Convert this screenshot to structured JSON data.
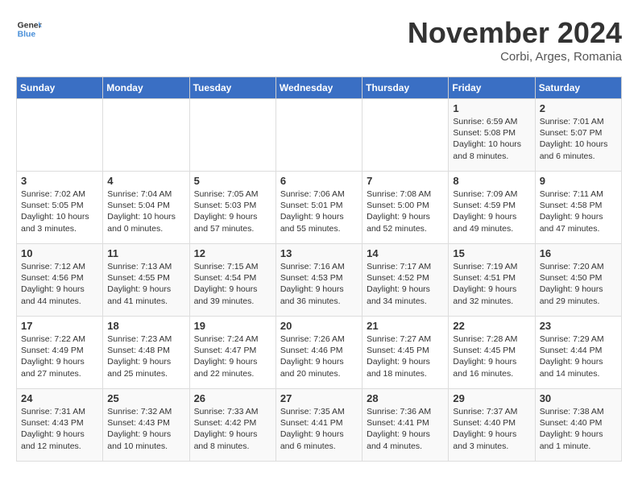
{
  "header": {
    "logo_general": "General",
    "logo_blue": "Blue",
    "month_title": "November 2024",
    "location": "Corbi, Arges, Romania"
  },
  "weekdays": [
    "Sunday",
    "Monday",
    "Tuesday",
    "Wednesday",
    "Thursday",
    "Friday",
    "Saturday"
  ],
  "weeks": [
    [
      {
        "day": "",
        "info": ""
      },
      {
        "day": "",
        "info": ""
      },
      {
        "day": "",
        "info": ""
      },
      {
        "day": "",
        "info": ""
      },
      {
        "day": "",
        "info": ""
      },
      {
        "day": "1",
        "info": "Sunrise: 6:59 AM\nSunset: 5:08 PM\nDaylight: 10 hours and 8 minutes."
      },
      {
        "day": "2",
        "info": "Sunrise: 7:01 AM\nSunset: 5:07 PM\nDaylight: 10 hours and 6 minutes."
      }
    ],
    [
      {
        "day": "3",
        "info": "Sunrise: 7:02 AM\nSunset: 5:05 PM\nDaylight: 10 hours and 3 minutes."
      },
      {
        "day": "4",
        "info": "Sunrise: 7:04 AM\nSunset: 5:04 PM\nDaylight: 10 hours and 0 minutes."
      },
      {
        "day": "5",
        "info": "Sunrise: 7:05 AM\nSunset: 5:03 PM\nDaylight: 9 hours and 57 minutes."
      },
      {
        "day": "6",
        "info": "Sunrise: 7:06 AM\nSunset: 5:01 PM\nDaylight: 9 hours and 55 minutes."
      },
      {
        "day": "7",
        "info": "Sunrise: 7:08 AM\nSunset: 5:00 PM\nDaylight: 9 hours and 52 minutes."
      },
      {
        "day": "8",
        "info": "Sunrise: 7:09 AM\nSunset: 4:59 PM\nDaylight: 9 hours and 49 minutes."
      },
      {
        "day": "9",
        "info": "Sunrise: 7:11 AM\nSunset: 4:58 PM\nDaylight: 9 hours and 47 minutes."
      }
    ],
    [
      {
        "day": "10",
        "info": "Sunrise: 7:12 AM\nSunset: 4:56 PM\nDaylight: 9 hours and 44 minutes."
      },
      {
        "day": "11",
        "info": "Sunrise: 7:13 AM\nSunset: 4:55 PM\nDaylight: 9 hours and 41 minutes."
      },
      {
        "day": "12",
        "info": "Sunrise: 7:15 AM\nSunset: 4:54 PM\nDaylight: 9 hours and 39 minutes."
      },
      {
        "day": "13",
        "info": "Sunrise: 7:16 AM\nSunset: 4:53 PM\nDaylight: 9 hours and 36 minutes."
      },
      {
        "day": "14",
        "info": "Sunrise: 7:17 AM\nSunset: 4:52 PM\nDaylight: 9 hours and 34 minutes."
      },
      {
        "day": "15",
        "info": "Sunrise: 7:19 AM\nSunset: 4:51 PM\nDaylight: 9 hours and 32 minutes."
      },
      {
        "day": "16",
        "info": "Sunrise: 7:20 AM\nSunset: 4:50 PM\nDaylight: 9 hours and 29 minutes."
      }
    ],
    [
      {
        "day": "17",
        "info": "Sunrise: 7:22 AM\nSunset: 4:49 PM\nDaylight: 9 hours and 27 minutes."
      },
      {
        "day": "18",
        "info": "Sunrise: 7:23 AM\nSunset: 4:48 PM\nDaylight: 9 hours and 25 minutes."
      },
      {
        "day": "19",
        "info": "Sunrise: 7:24 AM\nSunset: 4:47 PM\nDaylight: 9 hours and 22 minutes."
      },
      {
        "day": "20",
        "info": "Sunrise: 7:26 AM\nSunset: 4:46 PM\nDaylight: 9 hours and 20 minutes."
      },
      {
        "day": "21",
        "info": "Sunrise: 7:27 AM\nSunset: 4:45 PM\nDaylight: 9 hours and 18 minutes."
      },
      {
        "day": "22",
        "info": "Sunrise: 7:28 AM\nSunset: 4:45 PM\nDaylight: 9 hours and 16 minutes."
      },
      {
        "day": "23",
        "info": "Sunrise: 7:29 AM\nSunset: 4:44 PM\nDaylight: 9 hours and 14 minutes."
      }
    ],
    [
      {
        "day": "24",
        "info": "Sunrise: 7:31 AM\nSunset: 4:43 PM\nDaylight: 9 hours and 12 minutes."
      },
      {
        "day": "25",
        "info": "Sunrise: 7:32 AM\nSunset: 4:43 PM\nDaylight: 9 hours and 10 minutes."
      },
      {
        "day": "26",
        "info": "Sunrise: 7:33 AM\nSunset: 4:42 PM\nDaylight: 9 hours and 8 minutes."
      },
      {
        "day": "27",
        "info": "Sunrise: 7:35 AM\nSunset: 4:41 PM\nDaylight: 9 hours and 6 minutes."
      },
      {
        "day": "28",
        "info": "Sunrise: 7:36 AM\nSunset: 4:41 PM\nDaylight: 9 hours and 4 minutes."
      },
      {
        "day": "29",
        "info": "Sunrise: 7:37 AM\nSunset: 4:40 PM\nDaylight: 9 hours and 3 minutes."
      },
      {
        "day": "30",
        "info": "Sunrise: 7:38 AM\nSunset: 4:40 PM\nDaylight: 9 hours and 1 minute."
      }
    ]
  ]
}
